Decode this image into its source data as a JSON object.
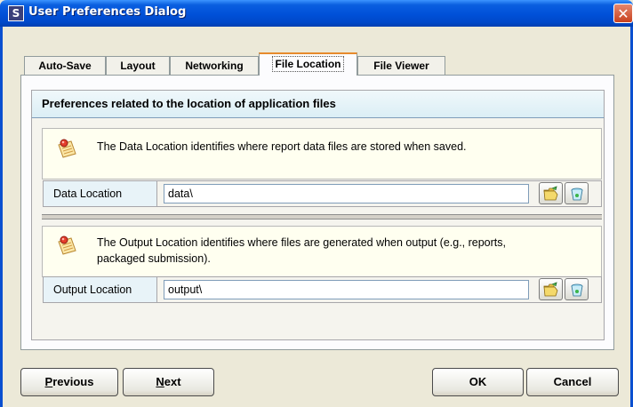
{
  "window": {
    "title": "User Preferences Dialog",
    "app_icon_letter": "S",
    "close_glyph": "✕"
  },
  "tabs": [
    {
      "label": "Auto-Save",
      "active": false
    },
    {
      "label": "Layout",
      "active": false
    },
    {
      "label": "Networking",
      "active": false
    },
    {
      "label": "File Location",
      "active": true
    },
    {
      "label": "File Viewer",
      "active": false
    }
  ],
  "panel": {
    "header": "Preferences related to the location of application files",
    "data_location": {
      "info": "The Data Location identifies where report data files are stored when saved.",
      "label": "Data Location",
      "value": "data\\",
      "browse_icon": "folder-open-icon",
      "clear_icon": "trash-icon"
    },
    "output_location": {
      "info_line1": "The Output Location identifies where files are generated when output (e.g., reports,",
      "info_line2": "packaged submission).",
      "label": "Output Location",
      "value": "output\\",
      "browse_icon": "folder-open-icon",
      "clear_icon": "trash-icon"
    }
  },
  "footer": {
    "previous": {
      "first": "P",
      "rest": "revious"
    },
    "next": {
      "first": "N",
      "rest": "ext"
    },
    "ok": "OK",
    "cancel": "Cancel"
  },
  "colors": {
    "title_bar": "#0050d8",
    "active_tab_accent": "#e68b2c",
    "section_header": "#dbeef5",
    "info_background": "#fffff0"
  }
}
